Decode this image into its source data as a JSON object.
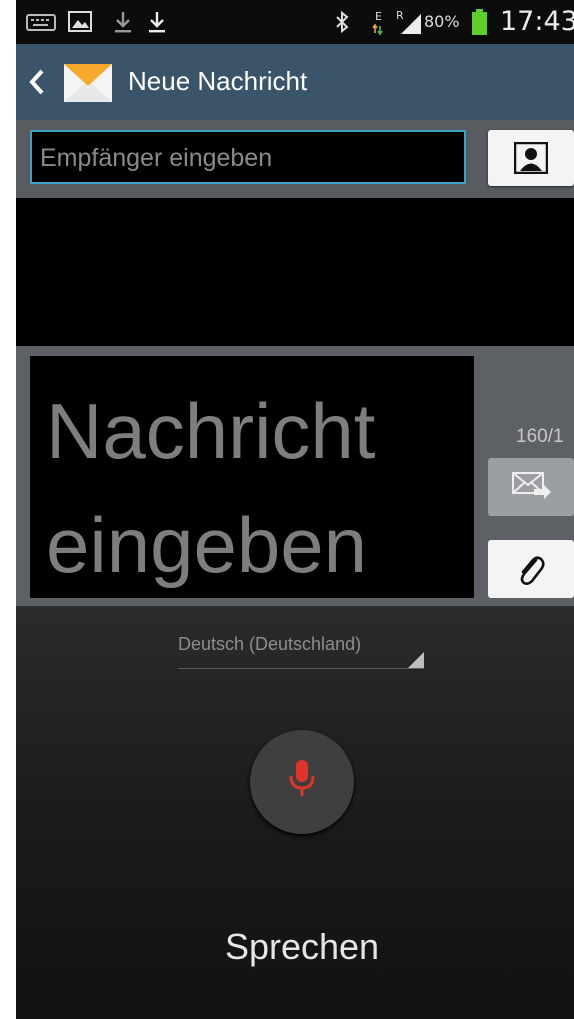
{
  "status_bar": {
    "battery_percent": "80%",
    "time": "17:43",
    "icons": [
      "keyboard-icon",
      "gallery-icon",
      "download-icon",
      "download-icon",
      "bluetooth-icon",
      "data-arrows-icon",
      "signal-icon",
      "battery-icon"
    ],
    "network_letters": {
      "data": "E",
      "roaming": "R"
    }
  },
  "action_bar": {
    "title": "Neue Nachricht",
    "icons": [
      "back-icon",
      "envelope-icon"
    ],
    "colors": {
      "background": "#3a5469"
    }
  },
  "recipient": {
    "placeholder": "Empfänger eingeben",
    "button_icon": "contact-icon",
    "accent": "#38a4c8"
  },
  "compose": {
    "placeholder": "Nachricht eingeben",
    "char_counter": "160/1",
    "send_icon": "send-icon",
    "attach_icon": "paperclip-icon"
  },
  "voice_input": {
    "language": "Deutsch (Deutschland)",
    "mic_icon": "microphone-icon",
    "mic_color": "#e0332c",
    "speak_label": "Sprechen"
  }
}
